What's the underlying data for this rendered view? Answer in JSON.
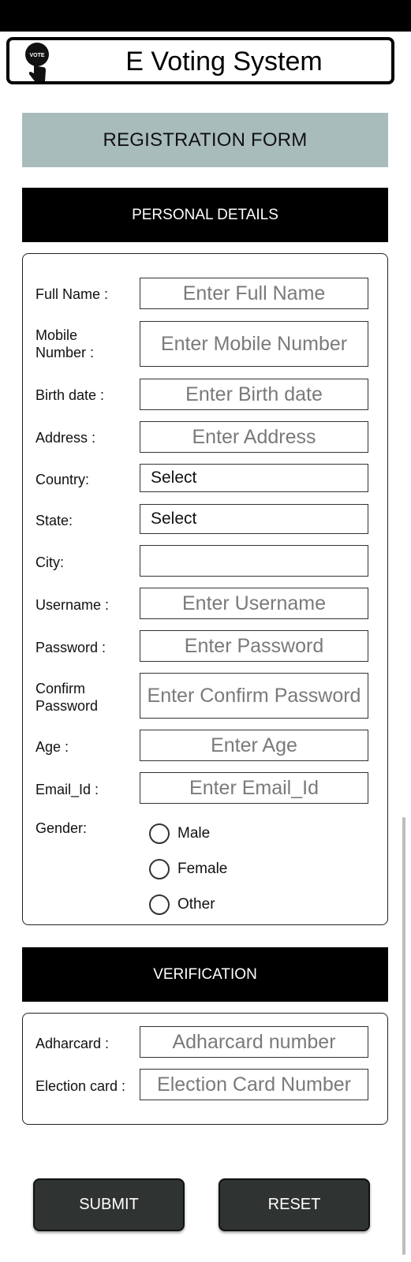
{
  "header": {
    "title": "E Voting System",
    "logo_text": "VOTE"
  },
  "form_banner": "REGISTRATION FORM",
  "personal": {
    "heading": "PERSONAL DETAILS",
    "fields": [
      {
        "label": "Full Name :",
        "placeholder": "Enter Full Name"
      },
      {
        "label": "Mobile Number :",
        "placeholder": "Enter Mobile Number"
      },
      {
        "label": "Birth date :",
        "placeholder": "Enter  Birth date"
      },
      {
        "label": "Address :",
        "placeholder": "Enter Address"
      },
      {
        "label": "Country:",
        "value": "Select"
      },
      {
        "label": "State:",
        "value": "Select"
      },
      {
        "label": "City:",
        "value": ""
      },
      {
        "label": "Username :",
        "placeholder": "Enter Username"
      },
      {
        "label": "Password :",
        "placeholder": "Enter Password"
      },
      {
        "label": "Confirm Password",
        "placeholder": "Enter Confirm Password"
      },
      {
        "label": "Age :",
        "placeholder": "Enter Age"
      },
      {
        "label": "Email_Id :",
        "placeholder": "Enter Email_Id"
      }
    ],
    "gender": {
      "label": "Gender:",
      "options": [
        "Male",
        "Female",
        "Other"
      ]
    }
  },
  "verification": {
    "heading": "VERIFICATION",
    "fields": [
      {
        "label": "Adharcard :",
        "placeholder": "Adharcard number"
      },
      {
        "label": "Election card :",
        "placeholder": "Election Card Number"
      }
    ]
  },
  "buttons": {
    "submit": "SUBMIT",
    "reset": "RESET"
  }
}
